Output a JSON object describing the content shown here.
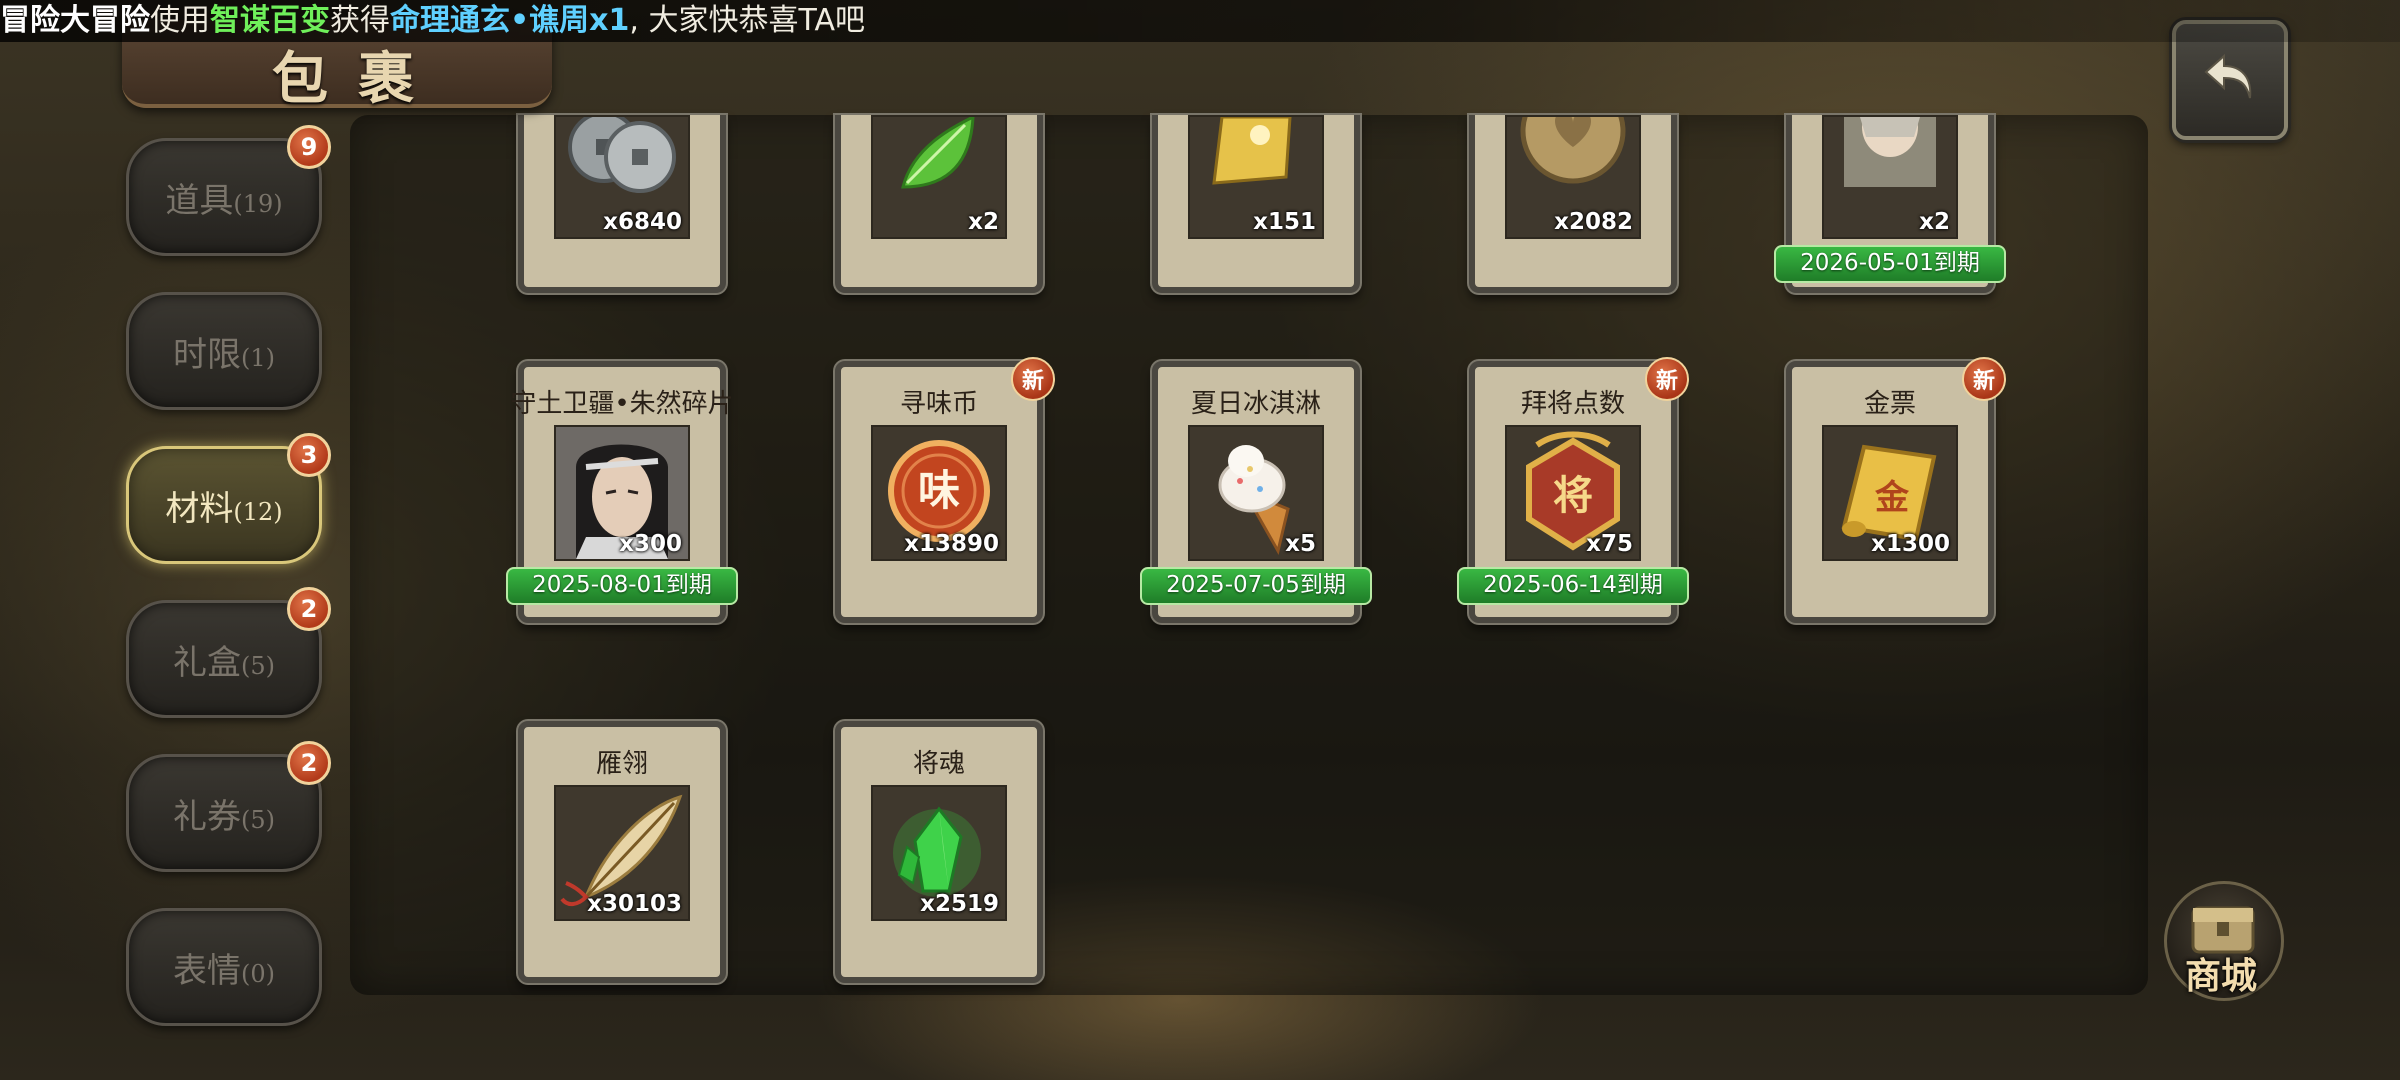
{
  "broadcast": {
    "player": "冒险大冒险",
    "text_use": "使用",
    "skill": "智谋百变",
    "text_obtain": "获得",
    "reward": "命理通玄•谯周x1",
    "text_end": ", 大家快恭喜TA吧"
  },
  "header": {
    "title": "包裹"
  },
  "tabs": [
    {
      "label": "道具",
      "count": "(19)",
      "badge": "9"
    },
    {
      "label": "时限",
      "count": "(1)",
      "badge": ""
    },
    {
      "label": "材料",
      "count": "(12)",
      "badge": "3",
      "active": true
    },
    {
      "label": "礼盒",
      "count": "(5)",
      "badge": "2"
    },
    {
      "label": "礼券",
      "count": "(5)",
      "badge": "2"
    },
    {
      "label": "表情",
      "count": "(0)",
      "badge": ""
    }
  ],
  "items": [
    {
      "name": "",
      "qty": "x6840",
      "expiry": "",
      "icon": "coins-icon"
    },
    {
      "name": "",
      "qty": "x2",
      "expiry": "",
      "icon": "jade-leaf-icon"
    },
    {
      "name": "",
      "qty": "x151",
      "expiry": "",
      "icon": "gold-ticket-icon"
    },
    {
      "name": "",
      "qty": "x2082",
      "expiry": "",
      "icon": "heart-medal-icon"
    },
    {
      "name": "",
      "qty": "x2",
      "expiry": "2026-05-01到期",
      "icon": "portrait-shard-icon"
    },
    {
      "name": "守土卫疆•朱然碎片",
      "qty": "x300",
      "expiry": "2025-08-01到期",
      "icon": "general-portrait-icon",
      "new": ""
    },
    {
      "name": "寻味币",
      "qty": "x13890",
      "expiry": "",
      "icon": "taste-coin-icon",
      "new": "新"
    },
    {
      "name": "夏日冰淇淋",
      "qty": "x5",
      "expiry": "2025-07-05到期",
      "icon": "ice-cream-icon",
      "new": ""
    },
    {
      "name": "拜将点数",
      "qty": "x75",
      "expiry": "2025-06-14到期",
      "icon": "general-token-icon",
      "new": "新"
    },
    {
      "name": "金票",
      "qty": "x1300",
      "expiry": "",
      "icon": "gold-scroll-icon",
      "new": "新"
    },
    {
      "name": "雁翎",
      "qty": "x30103",
      "expiry": "",
      "icon": "feather-icon"
    },
    {
      "name": "将魂",
      "qty": "x2519",
      "expiry": "",
      "icon": "green-crystal-icon"
    }
  ],
  "icon_glyphs": {
    "taste_coin": "味",
    "general_token": "将",
    "gold_scroll": "金"
  },
  "shop": {
    "label": "商城"
  },
  "colors": {
    "expiry_green": "#2ea23a",
    "badge_red": "#c2441f",
    "active_tab_gold": "#d9c77a"
  }
}
